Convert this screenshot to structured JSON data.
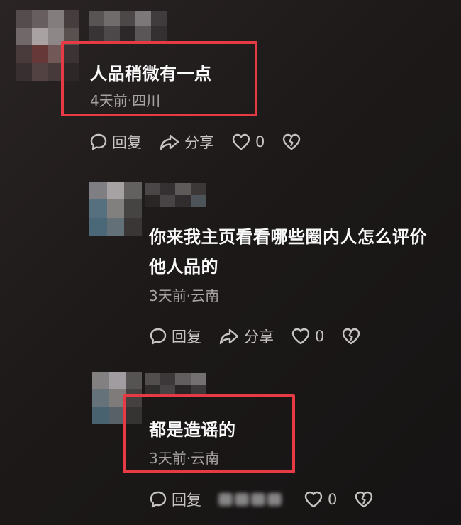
{
  "comments": [
    {
      "text": "人品稍微有一点",
      "meta": "4天前·四川",
      "reply_label": "回复",
      "share_label": "分享",
      "like_count": "0"
    },
    {
      "text_line1": "你来我主页看看哪些圈内人怎么评价",
      "text_line2": "他人品的",
      "meta": "3天前·云南",
      "reply_label": "回复",
      "share_label": "分享",
      "like_count": "0"
    },
    {
      "text": "都是造谣的",
      "meta": "3天前·云南",
      "reply_label": "回复",
      "like_count": "0"
    }
  ],
  "colors": {
    "highlight_box": "#e63b44",
    "background": "#1d1919",
    "meta_text": "#a8a3a3",
    "action_text": "#c9c4c4"
  },
  "icons": [
    "chat-bubble-icon",
    "share-arrow-icon",
    "heart-icon",
    "broken-heart-icon"
  ]
}
